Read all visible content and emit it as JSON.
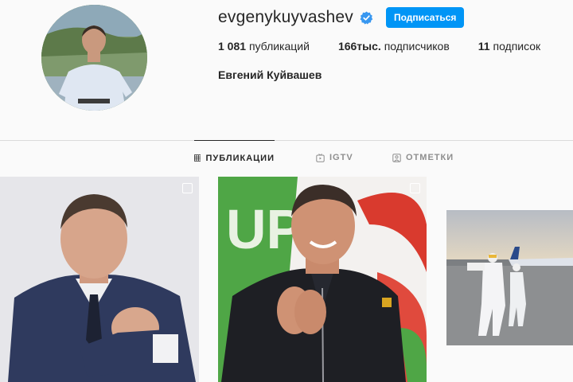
{
  "profile": {
    "username": "evgenykuyvashev",
    "follow_label": "Подписаться",
    "full_name": "Евгений Куйвашев",
    "stats": [
      {
        "value": "1 081",
        "label": "публикаций"
      },
      {
        "value": "166тыс.",
        "label": "подписчиков"
      },
      {
        "value": "11",
        "label": "подписок"
      }
    ]
  },
  "tabs": [
    {
      "label": "ПУБЛИКАЦИИ",
      "icon": "grid-icon",
      "active": true
    },
    {
      "label": "IGTV",
      "icon": "igtv-icon",
      "active": false
    },
    {
      "label": "ОТМЕТКИ",
      "icon": "tagged-icon",
      "active": false
    }
  ],
  "posts": [
    {
      "content": "portrait-suit"
    },
    {
      "content": "portrait-sports-jacket"
    },
    {
      "content": "airport-hazmat"
    }
  ],
  "colors": {
    "accent": "#0095f6",
    "verified": "#3897f0",
    "text": "#262626",
    "muted": "#8e8e8e",
    "divider": "#dbdbdb"
  }
}
